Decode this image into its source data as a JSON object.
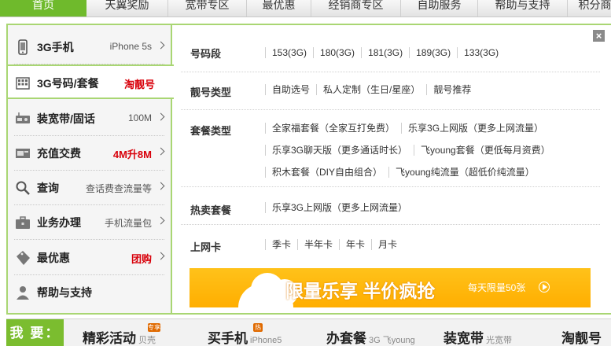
{
  "top_nav": {
    "tabs": [
      {
        "label": "首页",
        "active": true
      },
      {
        "label": "天翼奖励",
        "active": false
      },
      {
        "label": "宽带专区",
        "active": false
      },
      {
        "label": "最优惠",
        "active": false
      },
      {
        "label": "经销商专区",
        "active": false
      },
      {
        "label": "自助服务",
        "active": false
      },
      {
        "label": "帮助与支持",
        "active": false
      },
      {
        "label": "积分商",
        "active": false
      }
    ]
  },
  "sidebar": {
    "items": [
      {
        "label": "3G手机",
        "tag": "iPhone 5s",
        "icon": "phone-icon"
      },
      {
        "label": "3G号码/套餐",
        "tag": "淘靓号",
        "icon": "grid-icon",
        "active": true
      },
      {
        "label": "装宽带/固话",
        "tag": "100M",
        "icon": "broadband-icon"
      },
      {
        "label": "充值交费",
        "tag": "4M升8M",
        "icon": "card-icon"
      },
      {
        "label": "查询",
        "tag": "查话费查流量等",
        "icon": "magnifier-icon"
      },
      {
        "label": "业务办理",
        "tag": "手机流量包",
        "icon": "briefcase-icon"
      },
      {
        "label": "最优惠",
        "tag": "团购",
        "icon": "sale-tag-icon"
      },
      {
        "label": "帮助与支持",
        "tag": "",
        "icon": "person-icon"
      }
    ]
  },
  "panel": {
    "close_label": "×",
    "rows": [
      {
        "label": "号码段",
        "lines": [
          [
            "153(3G)",
            "180(3G)",
            "181(3G)",
            "189(3G)",
            "133(3G)"
          ]
        ]
      },
      {
        "label": "靓号类型",
        "lines": [
          [
            "自助选号",
            "私人定制（生日/星座）",
            "靓号推荐"
          ]
        ]
      },
      {
        "label": "套餐类型",
        "lines": [
          [
            "全家福套餐（全家互打免费）",
            "乐享3G上网版（更多上网流量）"
          ],
          [
            "乐享3G聊天版（更多通话时长）",
            "飞young套餐（更低每月资费）"
          ],
          [
            "积木套餐（DIY自由组合）",
            "飞young纯流量（超低价纯流量）"
          ]
        ]
      },
      {
        "label": "热卖套餐",
        "lines": [
          [
            "乐享3G上网版（更多上网流量）"
          ]
        ]
      },
      {
        "label": "上网卡",
        "lines": [
          [
            "季卡",
            "半年卡",
            "年卡",
            "月卡"
          ]
        ]
      }
    ]
  },
  "banner": {
    "title": "限量乐享 半价疯抢",
    "subtitle": "每天限量50张"
  },
  "bottom_bar": {
    "want_label": "我 要：",
    "items": [
      {
        "big": "精彩活动",
        "small": "贝壳",
        "badge": "专享"
      },
      {
        "big": "买手机",
        "small": "iPhone5",
        "badge": "热"
      },
      {
        "big": "办套餐",
        "small": "3G 飞young",
        "badge": ""
      },
      {
        "big": "装宽带",
        "small": "光宽带",
        "badge": ""
      },
      {
        "big": "淘靓号",
        "small": "",
        "badge": ""
      }
    ]
  },
  "colors": {
    "accent_green": "#6fba2c",
    "border_green": "#a9d673",
    "banner_orange": "#ffb300",
    "promo_red": "#d8000a"
  }
}
